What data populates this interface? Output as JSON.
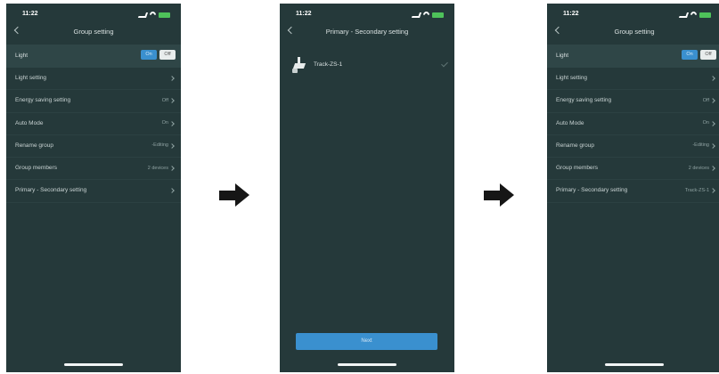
{
  "screen1": {
    "time": "11:22",
    "title": "Group setting",
    "light_label": "Light",
    "on_label": "On",
    "off_label": "Off",
    "rows": [
      {
        "label": "Light setting",
        "value": ""
      },
      {
        "label": "Energy saving setting",
        "value": "Off"
      },
      {
        "label": "Auto Mode",
        "value": "On"
      },
      {
        "label": "Rename group",
        "value": "-Editing"
      },
      {
        "label": "Group members",
        "value": "2 devices"
      },
      {
        "label": "Primary - Secondary setting",
        "value": ""
      }
    ]
  },
  "screen2": {
    "time": "11:22",
    "title": "Primary - Secondary setting",
    "device_name": "Track-ZS-1",
    "next_label": "Next"
  },
  "screen3": {
    "time": "11:22",
    "title": "Group setting",
    "light_label": "Light",
    "on_label": "On",
    "off_label": "Off",
    "rows": [
      {
        "label": "Light setting",
        "value": ""
      },
      {
        "label": "Energy saving setting",
        "value": "Off"
      },
      {
        "label": "Auto Mode",
        "value": "On"
      },
      {
        "label": "Rename group",
        "value": "-Editing"
      },
      {
        "label": "Group members",
        "value": "2 devices"
      },
      {
        "label": "Primary - Secondary setting",
        "value": "Track-ZS-1"
      }
    ]
  },
  "colors": {
    "screen_bg": "#25393a",
    "accent": "#3a90cf",
    "battery": "#4ec25a"
  }
}
